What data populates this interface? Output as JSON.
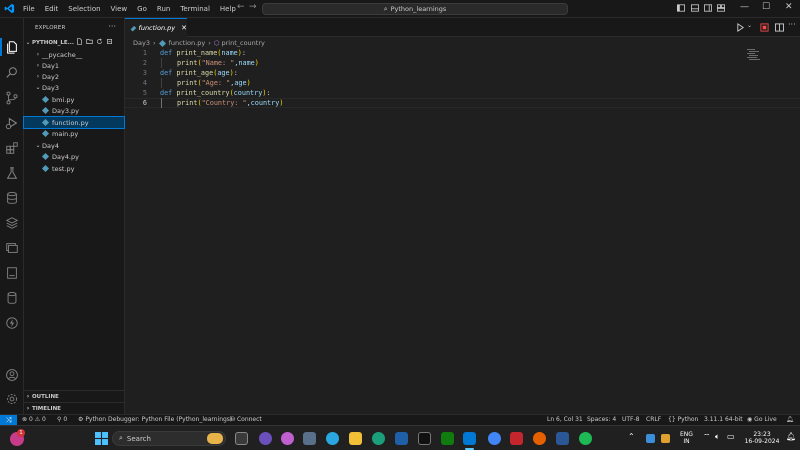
{
  "titlebar": {
    "menu": [
      "File",
      "Edit",
      "Selection",
      "View",
      "Go",
      "Run",
      "Terminal",
      "Help"
    ],
    "search_text": "Python_learnings"
  },
  "sidebar": {
    "header": "EXPLORER",
    "root": "PYTHON_LE...",
    "items": [
      {
        "label": "__pycache__",
        "kind": "folder",
        "expanded": false
      },
      {
        "label": "Day1",
        "kind": "folder",
        "expanded": false
      },
      {
        "label": "Day2",
        "kind": "folder",
        "expanded": false
      },
      {
        "label": "Day3",
        "kind": "folder",
        "expanded": true
      },
      {
        "label": "bmi.py",
        "kind": "file"
      },
      {
        "label": "Day3.py",
        "kind": "file"
      },
      {
        "label": "function.py",
        "kind": "file",
        "selected": true
      },
      {
        "label": "main.py",
        "kind": "file"
      },
      {
        "label": "Day4",
        "kind": "folder",
        "expanded": true
      },
      {
        "label": "Day4.py",
        "kind": "file"
      },
      {
        "label": "test.py",
        "kind": "file"
      }
    ],
    "outline": "OUTLINE",
    "timeline": "TIMELINE"
  },
  "editor": {
    "tab_label": "function.py",
    "breadcrumb": [
      "Day3",
      "function.py",
      "print_country"
    ],
    "line_numbers": [
      "1",
      "2",
      "3",
      "4",
      "5",
      "6"
    ],
    "code": {
      "l1": {
        "kw": "def",
        "fn": "print_name",
        "param": "name"
      },
      "l2": {
        "fn": "print",
        "str": "\"Name: \"",
        "arg": "name"
      },
      "l3": {
        "kw": "def",
        "fn": "print_age",
        "param": "age"
      },
      "l4": {
        "fn": "print",
        "str": "\"Age: \"",
        "arg": "age"
      },
      "l5": {
        "kw": "def",
        "fn": "print_country",
        "param": "country"
      },
      "l6": {
        "fn": "print",
        "str": "\"Country: \"",
        "arg": "country"
      }
    }
  },
  "statusbar": {
    "errors": "0",
    "warnings": "0",
    "ports": "0",
    "debugger": "Python Debugger: Python File (Python_learnings)",
    "connect": "Connect",
    "position": "Ln 6, Col 31",
    "spaces": "Spaces: 4",
    "encoding": "UTF-8",
    "eol": "CRLF",
    "language": "Python",
    "interpreter": "3.11.1 64-bit",
    "golive": "Go Live"
  },
  "taskbar": {
    "search_placeholder": "Search",
    "notification_count": "1",
    "lang_top": "ENG",
    "lang_bottom": "IN",
    "time": "23:23",
    "date": "16-09-2024"
  },
  "colors": {
    "accent": "#0078d4",
    "keyword": "#569cd6",
    "function": "#dcdcaa",
    "string": "#ce9178",
    "parameter": "#9cdcfe"
  }
}
